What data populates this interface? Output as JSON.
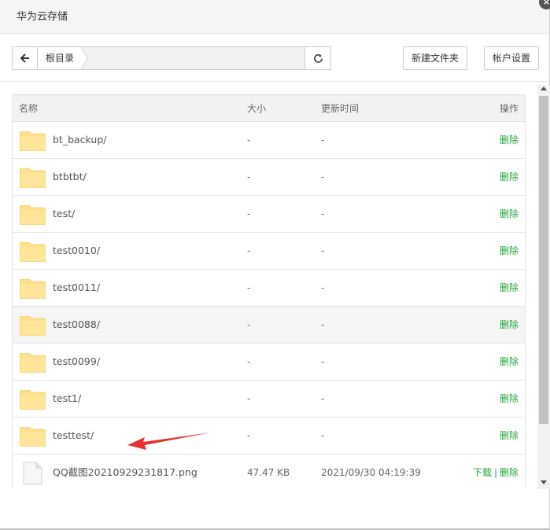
{
  "window": {
    "title": "华为云存储",
    "close_glyph": "×"
  },
  "toolbar": {
    "back_icon": "back-arrow-icon",
    "crumb": "根目录",
    "refresh_icon": "refresh-icon",
    "new_folder_label": "新建文件夹",
    "account_settings_label": "帐户设置"
  },
  "table": {
    "headers": {
      "name": "名称",
      "size": "大小",
      "time": "更新时间",
      "ops": "操作"
    },
    "rows": [
      {
        "type": "folder",
        "name": "bt_backup/",
        "size": "-",
        "time": "-",
        "delete": "删除"
      },
      {
        "type": "folder",
        "name": "btbtbt/",
        "size": "-",
        "time": "-",
        "delete": "删除"
      },
      {
        "type": "folder",
        "name": "test/",
        "size": "-",
        "time": "-",
        "delete": "删除"
      },
      {
        "type": "folder",
        "name": "test0010/",
        "size": "-",
        "time": "-",
        "delete": "删除"
      },
      {
        "type": "folder",
        "name": "test0011/",
        "size": "-",
        "time": "-",
        "delete": "删除"
      },
      {
        "type": "folder",
        "name": "test0088/",
        "size": "-",
        "time": "-",
        "delete": "删除",
        "highlighted": true
      },
      {
        "type": "folder",
        "name": "test0099/",
        "size": "-",
        "time": "-",
        "delete": "删除"
      },
      {
        "type": "folder",
        "name": "test1/",
        "size": "-",
        "time": "-",
        "delete": "删除"
      },
      {
        "type": "folder",
        "name": "testtest/",
        "size": "-",
        "time": "-",
        "delete": "删除"
      },
      {
        "type": "file",
        "name": "QQ截图20210929231817.png",
        "size": "47.47 KB",
        "time": "2021/09/30 04:19:39",
        "download": "下载",
        "separator": "|",
        "delete": "删除"
      }
    ]
  },
  "colors": {
    "accent_green": "#20a53a",
    "folder_yellow": "#ffe08a",
    "annotation_red": "#e8312f"
  }
}
